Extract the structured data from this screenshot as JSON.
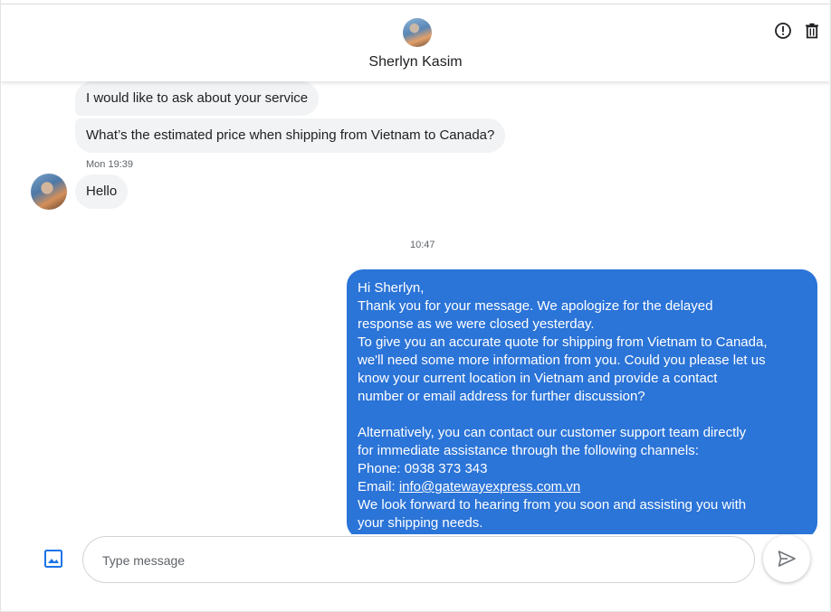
{
  "header": {
    "contact_name": "Sherlyn Kasim"
  },
  "icons": {
    "report": "report-icon",
    "delete": "trash-icon",
    "image": "image-icon",
    "send": "send-icon"
  },
  "messages": {
    "incoming": [
      {
        "text": "I would like to ask about your service"
      },
      {
        "text": "What’s the estimated price when shipping from Vietnam to Canada?"
      },
      {
        "text": "Hello"
      }
    ],
    "incoming_time": "Mon 19:39",
    "reply_time": "10:47",
    "reply": {
      "lines": [
        "Hi Sherlyn,",
        "Thank you for your message. We apologize for the delayed",
        "response as we were closed yesterday.",
        "To give you an accurate quote for shipping from Vietnam to Canada,",
        "we'll need some more information from you. Could you please let us",
        "know your current location in Vietnam and provide a contact",
        "number or email address for further discussion?",
        "",
        "Alternatively, you can contact our customer support team directly",
        "for immediate assistance through the following channels:",
        "Phone: 0938 373 343"
      ],
      "email_prefix": "Email: ",
      "email": "info@gatewayexpress.com.vn",
      "closing_lines": [
        "We look forward to hearing from you soon and assisting you with",
        "your shipping needs."
      ]
    }
  },
  "composer": {
    "placeholder": "Type message",
    "value": ""
  },
  "colors": {
    "outgoing_bubble": "#2b74d8",
    "incoming_bubble": "#f1f3f4",
    "icon_blue": "#1a73e8"
  }
}
